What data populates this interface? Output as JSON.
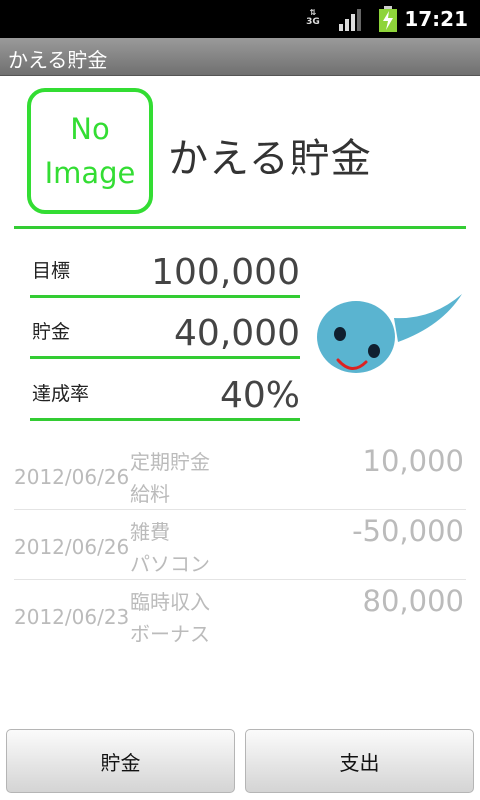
{
  "status_bar": {
    "network": "3G",
    "time": "17:21"
  },
  "title_bar": {
    "title": "かえる貯金"
  },
  "header": {
    "image_placeholder": {
      "line1": "No",
      "line2": "Image"
    },
    "app_name": "かえる貯金"
  },
  "summary": [
    {
      "label": "目標",
      "value": "100,000"
    },
    {
      "label": "貯金",
      "value": "40,000"
    },
    {
      "label": "達成率",
      "value": "40%"
    }
  ],
  "transactions": [
    {
      "date": "2012/06/26",
      "category": "定期貯金",
      "memo": "給料",
      "amount": "10,000"
    },
    {
      "date": "2012/06/26",
      "category": "雑費",
      "memo": "パソコン",
      "amount": "-50,000"
    },
    {
      "date": "2012/06/23",
      "category": "臨時収入",
      "memo": "ボーナス",
      "amount": "80,000"
    }
  ],
  "buttons": {
    "save": "貯金",
    "spend": "支出"
  },
  "colors": {
    "accent": "#33cc33",
    "mascot": "#5ab4d0",
    "smile": "#dd2222"
  },
  "icons": {
    "network": "network-3g-icon",
    "signal": "signal-strength-icon",
    "battery": "battery-charging-icon",
    "mascot": "tadpole-mascot-icon"
  }
}
